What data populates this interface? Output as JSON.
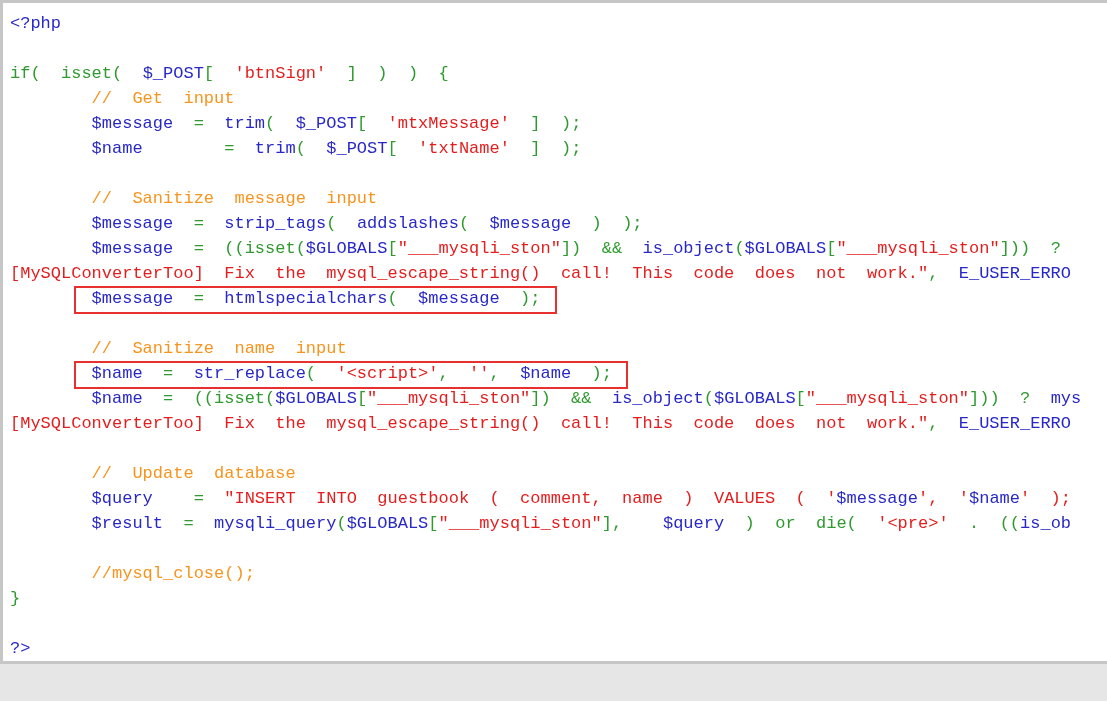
{
  "code_view": {
    "lines": [
      {
        "kind": "code",
        "tokens": [
          {
            "kind": "tag",
            "text": "<?php"
          }
        ]
      },
      {
        "kind": "blank"
      },
      {
        "kind": "code",
        "tokens": [
          {
            "kind": "kw",
            "text": "if(  isset(  "
          },
          {
            "kind": "var",
            "text": "$_POST"
          },
          {
            "kind": "op",
            "text": "[  "
          },
          {
            "kind": "str",
            "text": "'btnSign'"
          },
          {
            "kind": "op",
            "text": "  ]  )  )  {"
          }
        ],
        "children": [
          {
            "kind": "code",
            "tokens": [
              {
                "kind": "com",
                "text": "//  Get  input"
              }
            ]
          },
          {
            "kind": "code",
            "tokens": [
              {
                "kind": "var",
                "text": "$message"
              },
              {
                "kind": "op",
                "text": "  =  "
              },
              {
                "kind": "fn",
                "text": "trim"
              },
              {
                "kind": "op",
                "text": "(  "
              },
              {
                "kind": "var",
                "text": "$_POST"
              },
              {
                "kind": "op",
                "text": "[  "
              },
              {
                "kind": "str",
                "text": "'mtxMessage'"
              },
              {
                "kind": "op",
                "text": "  ]  );"
              }
            ]
          },
          {
            "kind": "code",
            "tokens": [
              {
                "kind": "var",
                "text": "$name"
              },
              {
                "kind": "op",
                "text": "        =  "
              },
              {
                "kind": "fn",
                "text": "trim"
              },
              {
                "kind": "op",
                "text": "(  "
              },
              {
                "kind": "var",
                "text": "$_POST"
              },
              {
                "kind": "op",
                "text": "[  "
              },
              {
                "kind": "str",
                "text": "'txtName'"
              },
              {
                "kind": "op",
                "text": "  ]  );"
              }
            ]
          },
          {
            "kind": "blank"
          },
          {
            "kind": "code",
            "tokens": [
              {
                "kind": "com",
                "text": "//  Sanitize  message  input"
              }
            ]
          },
          {
            "kind": "code",
            "tokens": [
              {
                "kind": "var",
                "text": "$message"
              },
              {
                "kind": "op",
                "text": "  =  "
              },
              {
                "kind": "fn",
                "text": "strip_tags"
              },
              {
                "kind": "op",
                "text": "(  "
              },
              {
                "kind": "fn",
                "text": "addslashes"
              },
              {
                "kind": "op",
                "text": "(  "
              },
              {
                "kind": "var",
                "text": "$message"
              },
              {
                "kind": "op",
                "text": "  )  );"
              }
            ]
          },
          {
            "kind": "code",
            "tokens": [
              {
                "kind": "var",
                "text": "$message"
              },
              {
                "kind": "op",
                "text": "  =  ((isset("
              },
              {
                "kind": "var",
                "text": "$GLOBALS"
              },
              {
                "kind": "op",
                "text": "["
              },
              {
                "kind": "str",
                "text": "\"___mysqli_ston\""
              },
              {
                "kind": "op",
                "text": "])  &&  "
              },
              {
                "kind": "fn",
                "text": "is_object"
              },
              {
                "kind": "op",
                "text": "("
              },
              {
                "kind": "var",
                "text": "$GLOBALS"
              },
              {
                "kind": "op",
                "text": "["
              },
              {
                "kind": "str",
                "text": "\"___mysqli_ston\""
              },
              {
                "kind": "op",
                "text": "]))  ?"
              }
            ]
          },
          {
            "kind": "wrapped",
            "tokens": [
              {
                "kind": "str",
                "text": "[MySQLConverterToo]  Fix  the  mysql_escape_string()  call!  This  code  does  not  work.\""
              },
              {
                "kind": "op",
                "text": ",  "
              },
              {
                "kind": "var",
                "text": "E_USER_ERRO"
              }
            ]
          },
          {
            "kind": "code",
            "highlighted": true,
            "tokens": [
              {
                "kind": "var",
                "text": "$message"
              },
              {
                "kind": "op",
                "text": "  =  "
              },
              {
                "kind": "fn",
                "text": "htmlspecialchars"
              },
              {
                "kind": "op",
                "text": "(  "
              },
              {
                "kind": "var",
                "text": "$message"
              },
              {
                "kind": "op",
                "text": "  );"
              }
            ]
          },
          {
            "kind": "blank"
          },
          {
            "kind": "code",
            "tokens": [
              {
                "kind": "com",
                "text": "//  Sanitize  name  input"
              }
            ]
          },
          {
            "kind": "code",
            "highlighted": true,
            "tokens": [
              {
                "kind": "var",
                "text": "$name"
              },
              {
                "kind": "op",
                "text": "  =  "
              },
              {
                "kind": "fn",
                "text": "str_replace"
              },
              {
                "kind": "op",
                "text": "(  "
              },
              {
                "kind": "str",
                "text": "'<script>'"
              },
              {
                "kind": "op",
                "text": ",  "
              },
              {
                "kind": "str",
                "text": "''"
              },
              {
                "kind": "op",
                "text": ",  "
              },
              {
                "kind": "var",
                "text": "$name"
              },
              {
                "kind": "op",
                "text": "  );"
              }
            ]
          },
          {
            "kind": "code",
            "tokens": [
              {
                "kind": "var",
                "text": "$name"
              },
              {
                "kind": "op",
                "text": "  =  ((isset("
              },
              {
                "kind": "var",
                "text": "$GLOBALS"
              },
              {
                "kind": "op",
                "text": "["
              },
              {
                "kind": "str",
                "text": "\"___mysqli_ston\""
              },
              {
                "kind": "op",
                "text": "])  &&  "
              },
              {
                "kind": "fn",
                "text": "is_object"
              },
              {
                "kind": "op",
                "text": "("
              },
              {
                "kind": "var",
                "text": "$GLOBALS"
              },
              {
                "kind": "op",
                "text": "["
              },
              {
                "kind": "str",
                "text": "\"___mysqli_ston\""
              },
              {
                "kind": "op",
                "text": "]))  ?  "
              },
              {
                "kind": "fn",
                "text": "mys"
              }
            ]
          },
          {
            "kind": "wrapped",
            "tokens": [
              {
                "kind": "str",
                "text": "[MySQLConverterToo]  Fix  the  mysql_escape_string()  call!  This  code  does  not  work.\""
              },
              {
                "kind": "op",
                "text": ",  "
              },
              {
                "kind": "var",
                "text": "E_USER_ERRO"
              }
            ]
          },
          {
            "kind": "blank"
          },
          {
            "kind": "code",
            "tokens": [
              {
                "kind": "com",
                "text": "//  Update  database"
              }
            ]
          },
          {
            "kind": "code",
            "tokens": [
              {
                "kind": "var",
                "text": "$query"
              },
              {
                "kind": "op",
                "text": "    =  "
              },
              {
                "kind": "str",
                "text": "\"INSERT  INTO  guestbook  (  comment,  name  )  VALUES  (  '"
              },
              {
                "kind": "var",
                "text": "$message"
              },
              {
                "kind": "str",
                "text": "',  '"
              },
              {
                "kind": "var",
                "text": "$name"
              },
              {
                "kind": "str",
                "text": "'  );"
              }
            ]
          },
          {
            "kind": "code",
            "tokens": [
              {
                "kind": "var",
                "text": "$result"
              },
              {
                "kind": "op",
                "text": "  =  "
              },
              {
                "kind": "fn",
                "text": "mysqli_query"
              },
              {
                "kind": "op",
                "text": "("
              },
              {
                "kind": "var",
                "text": "$GLOBALS"
              },
              {
                "kind": "op",
                "text": "["
              },
              {
                "kind": "str",
                "text": "\"___mysqli_ston\""
              },
              {
                "kind": "op",
                "text": "],    "
              },
              {
                "kind": "var",
                "text": "$query"
              },
              {
                "kind": "op",
                "text": "  )  or  die(  "
              },
              {
                "kind": "str",
                "text": "'<pre>'"
              },
              {
                "kind": "op",
                "text": "  .  (("
              },
              {
                "kind": "fn",
                "text": "is_ob"
              }
            ]
          },
          {
            "kind": "blank"
          },
          {
            "kind": "code",
            "tokens": [
              {
                "kind": "com",
                "text": "//mysql_close();"
              }
            ]
          }
        ]
      },
      {
        "kind": "code",
        "tokens": [
          {
            "kind": "op",
            "text": "}"
          }
        ]
      },
      {
        "kind": "blank"
      },
      {
        "kind": "code",
        "tokens": [
          {
            "kind": "tag",
            "text": "?>"
          }
        ]
      }
    ]
  }
}
